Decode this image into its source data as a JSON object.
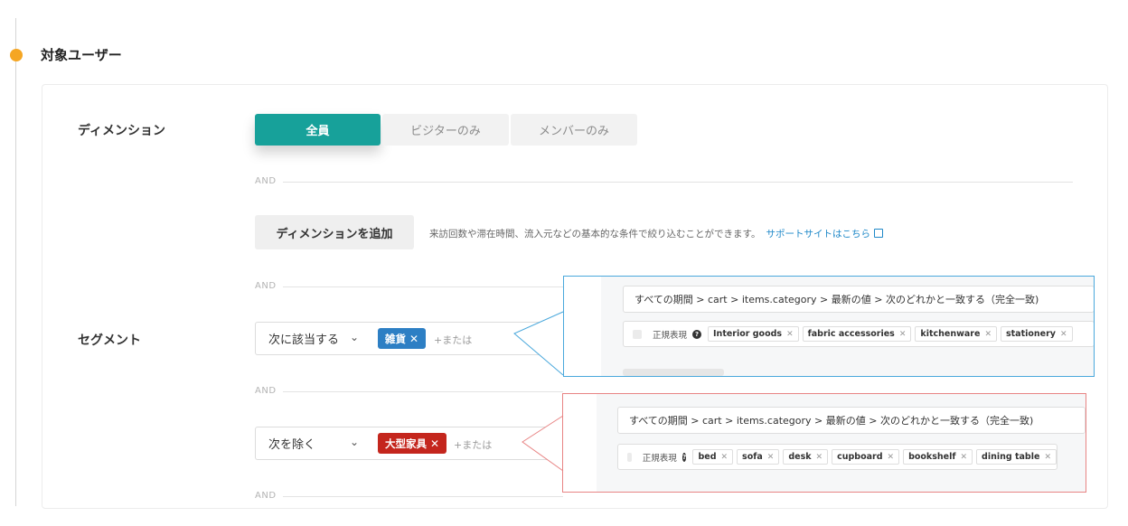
{
  "section": {
    "title": "対象ユーザー"
  },
  "colors": {
    "accent": "#17a19a",
    "blue_tag": "#2d7fc4",
    "red_tag": "#c4261d",
    "callout_blue": "#4aa8dc",
    "callout_red": "#e88484",
    "step_dot": "#f5a623"
  },
  "dimension": {
    "label": "ディメンション",
    "tabs": [
      {
        "label": "全員",
        "active": true
      },
      {
        "label": "ビジターのみ",
        "active": false
      },
      {
        "label": "メンバーのみ",
        "active": false
      }
    ],
    "add_button": "ディメンションを追加",
    "hint": "来訪回数や滞在時間、流入元などの基本的な条件で絞り込むことができます。",
    "support_link": "サポートサイトはこちら"
  },
  "and_label": "AND",
  "segment": {
    "label": "セグメント",
    "rows": [
      {
        "operator": "次に該当する",
        "chip": "雑貨",
        "or_text": "+または",
        "detail": {
          "path": "すべての期間 > cart > items.category > 最新の値 > 次のどれかと一致する（完全一致)",
          "regex_label": "正規表現",
          "tags": [
            "Interior goods",
            "fabric accessories",
            "kitchenware",
            "stationery"
          ]
        }
      },
      {
        "operator": "次を除く",
        "chip": "大型家具",
        "or_text": "+または",
        "detail": {
          "path": "すべての期間 > cart > items.category > 最新の値 > 次のどれかと一致する（完全一致)",
          "regex_label": "正規表現",
          "tags": [
            "bed",
            "sofa",
            "desk",
            "cupboard",
            "bookshelf",
            "dining table"
          ]
        }
      }
    ]
  },
  "icons": {
    "step": "step-dot-icon",
    "chevron": "chevron-down-icon",
    "external": "external-link-icon",
    "help": "help-icon",
    "remove": "remove-icon"
  }
}
